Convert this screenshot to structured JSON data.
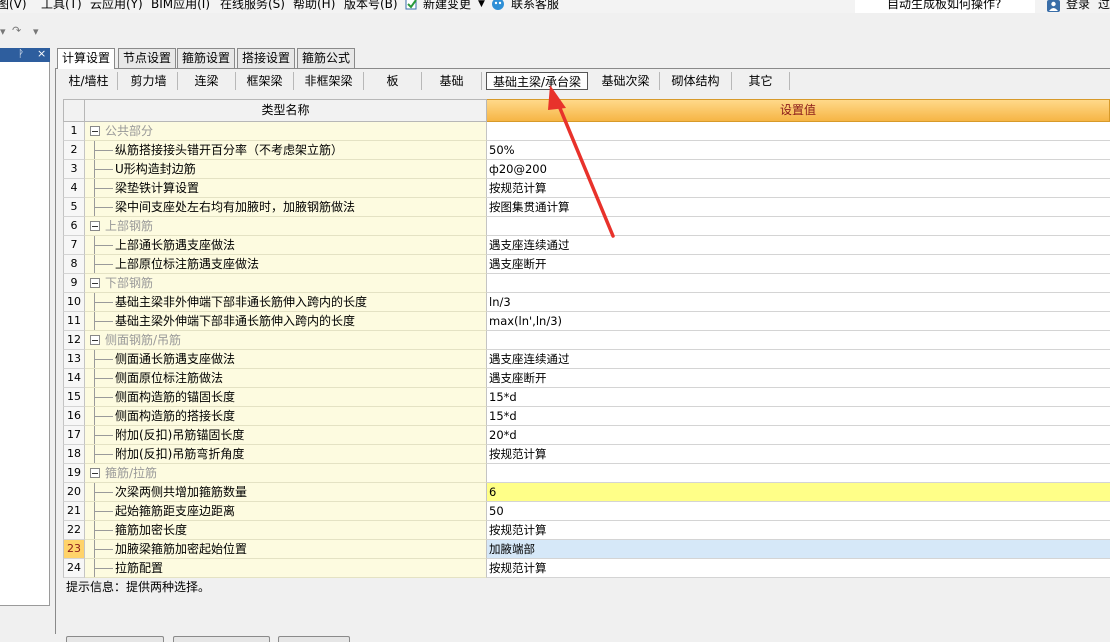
{
  "menu": {
    "items": [
      "图(V)",
      "工具(T)",
      "云应用(Y)",
      "BIM应用(I)",
      "在线服务(S)",
      "帮助(H)",
      "版本号(B)"
    ],
    "new_change": "新建变更",
    "support": "联系客服",
    "help_hint": "自动生成板如何操作?",
    "login": "登录",
    "cut_text": "过"
  },
  "left_panel": {
    "pin_icon": "pin-icon",
    "close_icon": "×"
  },
  "tabs": [
    "计算设置",
    "节点设置",
    "箍筋设置",
    "搭接设置",
    "箍筋公式"
  ],
  "active_tab": 0,
  "subtabs": [
    "柱/墙柱",
    "剪力墙",
    "连梁",
    "框架梁",
    "非框架梁",
    "板",
    "基础",
    "基础主梁/承台梁",
    "基础次梁",
    "砌体结构",
    "其它"
  ],
  "active_subtab": 7,
  "grid": {
    "col_name": "类型名称",
    "col_value": "设置值",
    "rows": [
      {
        "num": "1",
        "name": "公共部分",
        "group": true,
        "value": ""
      },
      {
        "num": "2",
        "name": "纵筋搭接接头错开百分率（不考虑架立筋）",
        "group": false,
        "value": "50%"
      },
      {
        "num": "3",
        "name": "U形构造封边筋",
        "group": false,
        "value": "ф20@200"
      },
      {
        "num": "4",
        "name": "梁垫铁计算设置",
        "group": false,
        "value": "按规范计算"
      },
      {
        "num": "5",
        "name": "梁中间支座处左右均有加腋时，加腋钢筋做法",
        "group": false,
        "value": "按图集贯通计算"
      },
      {
        "num": "6",
        "name": "上部钢筋",
        "group": true,
        "value": ""
      },
      {
        "num": "7",
        "name": "上部通长筋遇支座做法",
        "group": false,
        "value": "遇支座连续通过"
      },
      {
        "num": "8",
        "name": "上部原位标注筋遇支座做法",
        "group": false,
        "value": "遇支座断开"
      },
      {
        "num": "9",
        "name": "下部钢筋",
        "group": true,
        "value": ""
      },
      {
        "num": "10",
        "name": "基础主梁非外伸端下部非通长筋伸入跨内的长度",
        "group": false,
        "value": "ln/3"
      },
      {
        "num": "11",
        "name": "基础主梁外伸端下部非通长筋伸入跨内的长度",
        "group": false,
        "value": "max(ln',ln/3)"
      },
      {
        "num": "12",
        "name": "侧面钢筋/吊筋",
        "group": true,
        "value": ""
      },
      {
        "num": "13",
        "name": "侧面通长筋遇支座做法",
        "group": false,
        "value": "遇支座连续通过"
      },
      {
        "num": "14",
        "name": "侧面原位标注筋做法",
        "group": false,
        "value": "遇支座断开"
      },
      {
        "num": "15",
        "name": "侧面构造筋的锚固长度",
        "group": false,
        "value": "15*d"
      },
      {
        "num": "16",
        "name": "侧面构造筋的搭接长度",
        "group": false,
        "value": "15*d"
      },
      {
        "num": "17",
        "name": "附加(反扣)吊筋锚固长度",
        "group": false,
        "value": "20*d"
      },
      {
        "num": "18",
        "name": "附加(反扣)吊筋弯折角度",
        "group": false,
        "value": "按规范计算"
      },
      {
        "num": "19",
        "name": "箍筋/拉筋",
        "group": true,
        "value": ""
      },
      {
        "num": "20",
        "name": "次梁两侧共增加箍筋数量",
        "group": false,
        "value": "6"
      },
      {
        "num": "21",
        "name": "起始箍筋距支座边距离",
        "group": false,
        "value": "50"
      },
      {
        "num": "22",
        "name": "箍筋加密长度",
        "group": false,
        "value": "按规范计算"
      },
      {
        "num": "23",
        "name": "加腋梁箍筋加密起始位置",
        "group": false,
        "value": "加腋端部"
      },
      {
        "num": "24",
        "name": "拉筋配置",
        "group": false,
        "value": "按规范计算"
      }
    ]
  },
  "hint": {
    "label": "提示信息：提供两种选择。"
  },
  "colors": {
    "header_value_bg": "#f6b545",
    "name_col_bg": "#fdfbe0",
    "highlight_yellow": "#ffff88",
    "highlight_blue": "#d6e8f8",
    "arrow": "#e8322b"
  }
}
